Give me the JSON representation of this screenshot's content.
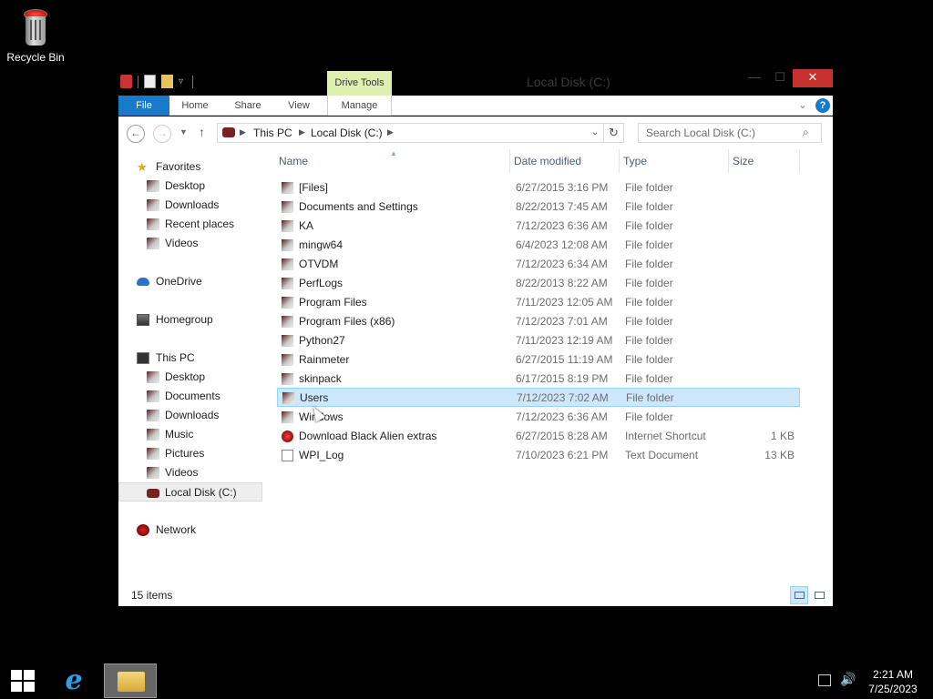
{
  "desktop": {
    "recycle_bin_label": "Recycle Bin"
  },
  "window": {
    "title": "Local Disk (C:)",
    "contextual_header": "Drive Tools",
    "ribbon_tabs": [
      "File",
      "Home",
      "Share",
      "View",
      "Manage"
    ],
    "close_glyph": "✕",
    "min_glyph": "—",
    "max_glyph": "☐"
  },
  "navbar": {
    "breadcrumb": [
      "This PC",
      "Local Disk (C:)"
    ],
    "search_placeholder": "Search Local Disk (C:)"
  },
  "navpane": {
    "favorites": "Favorites",
    "favorites_items": [
      "Desktop",
      "Downloads",
      "Recent places",
      "Videos"
    ],
    "onedrive": "OneDrive",
    "homegroup": "Homegroup",
    "thispc": "This PC",
    "thispc_items": [
      "Desktop",
      "Documents",
      "Downloads",
      "Music",
      "Pictures",
      "Videos",
      "Local Disk (C:)"
    ],
    "network": "Network",
    "selected": "Local Disk (C:)"
  },
  "columns": {
    "name": "Name",
    "date": "Date modified",
    "type": "Type",
    "size": "Size"
  },
  "files": [
    {
      "name": "[Files]",
      "date": "6/27/2015 3:16 PM",
      "type": "File folder",
      "size": "",
      "icon": "folder-icon"
    },
    {
      "name": "Documents and Settings",
      "date": "8/22/2013 7:45 AM",
      "type": "File folder",
      "size": "",
      "icon": "folder-icon"
    },
    {
      "name": "KA",
      "date": "7/12/2023 6:36 AM",
      "type": "File folder",
      "size": "",
      "icon": "folder-icon"
    },
    {
      "name": "mingw64",
      "date": "6/4/2023 12:08 AM",
      "type": "File folder",
      "size": "",
      "icon": "folder-icon"
    },
    {
      "name": "OTVDM",
      "date": "7/12/2023 6:34 AM",
      "type": "File folder",
      "size": "",
      "icon": "folder-icon"
    },
    {
      "name": "PerfLogs",
      "date": "8/22/2013 8:22 AM",
      "type": "File folder",
      "size": "",
      "icon": "folder-icon"
    },
    {
      "name": "Program Files",
      "date": "7/11/2023 12:05 AM",
      "type": "File folder",
      "size": "",
      "icon": "folder-icon"
    },
    {
      "name": "Program Files (x86)",
      "date": "7/12/2023 7:01 AM",
      "type": "File folder",
      "size": "",
      "icon": "folder-icon"
    },
    {
      "name": "Python27",
      "date": "7/11/2023 12:19 AM",
      "type": "File folder",
      "size": "",
      "icon": "folder-icon"
    },
    {
      "name": "Rainmeter",
      "date": "6/27/2015 11:19 AM",
      "type": "File folder",
      "size": "",
      "icon": "folder-icon"
    },
    {
      "name": "skinpack",
      "date": "6/17/2015 8:19 PM",
      "type": "File folder",
      "size": "",
      "icon": "folder-icon"
    },
    {
      "name": "Users",
      "date": "7/12/2023 7:02 AM",
      "type": "File folder",
      "size": "",
      "icon": "folder-icon"
    },
    {
      "name": "Windows",
      "date": "7/12/2023 6:36 AM",
      "type": "File folder",
      "size": "",
      "icon": "folder-icon"
    },
    {
      "name": "Download Black Alien extras",
      "date": "6/27/2015 8:28 AM",
      "type": "Internet Shortcut",
      "size": "1 KB",
      "icon": "internet-shortcut-icon"
    },
    {
      "name": "WPI_Log",
      "date": "7/10/2023 6:21 PM",
      "type": "Text Document",
      "size": "13 KB",
      "icon": "text-document-icon"
    }
  ],
  "selected_file": "Users",
  "status": {
    "items_count": "15 items"
  },
  "taskbar": {
    "time": "2:21 AM",
    "date": "7/25/2023",
    "ie_glyph": "e"
  }
}
